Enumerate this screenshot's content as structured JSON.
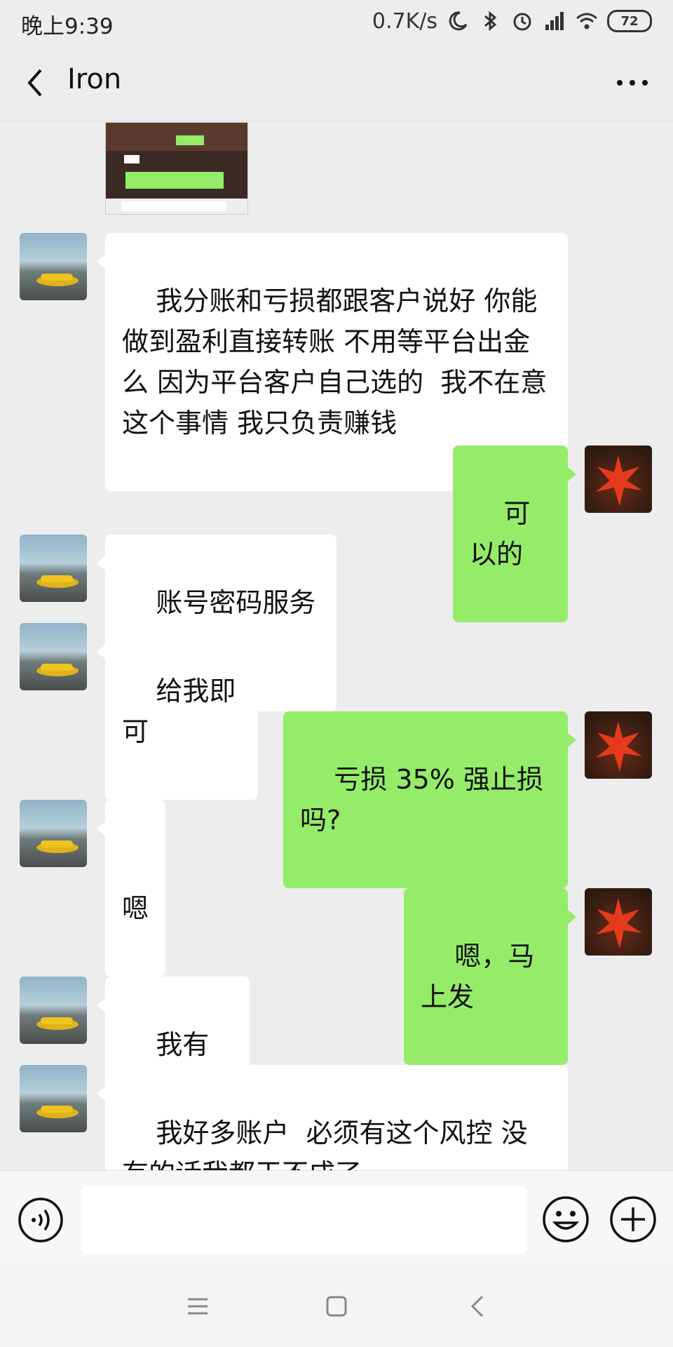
{
  "status_bar": {
    "time": "晚上9:39",
    "network_speed": "0.7K/s",
    "battery": "72",
    "icons": [
      "moon-icon",
      "bluetooth-icon",
      "alarm-icon",
      "signal-icon",
      "wifi-icon",
      "battery-icon"
    ]
  },
  "header": {
    "title": "Iron",
    "back_icon": "chevron-left-icon",
    "more_icon": "more-icon"
  },
  "messages": [
    {
      "from": "contact",
      "text": "我分账和亏损都跟客户说好 你能做到盈利直接转账 不用等平台出金么 因为平台客户自己选的  我不在意这个事情 我只负责赚钱"
    },
    {
      "from": "me",
      "text": "可以的"
    },
    {
      "from": "contact",
      "text": "账号密码服务器"
    },
    {
      "from": "contact",
      "text": "给我即可"
    },
    {
      "from": "me",
      "text": "亏损 35% 强止损吗?"
    },
    {
      "from": "contact",
      "text": "嗯"
    },
    {
      "from": "me",
      "text": "嗯，马上发"
    },
    {
      "from": "contact",
      "text": "我有系统"
    },
    {
      "from": "contact",
      "text": "我好多账户  必须有这个风控 没有的话我都干不成了"
    }
  ],
  "input_bar": {
    "placeholder": "",
    "voice_icon": "voice-icon",
    "emoji_icon": "emoji-icon",
    "plus_icon": "plus-icon"
  },
  "nav_bar": {
    "icons": [
      "menu-icon",
      "home-icon",
      "back-icon"
    ]
  },
  "colors": {
    "background": "#ededed",
    "bubble_in": "#ffffff",
    "bubble_out": "#95ec69"
  }
}
